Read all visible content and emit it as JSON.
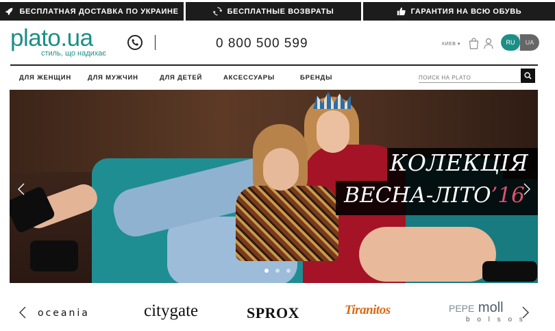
{
  "promo": {
    "items": [
      {
        "icon": "rocket-icon",
        "label": "БЕСПЛАТНАЯ ДОСТАВКА ПО УКРАИНЕ"
      },
      {
        "icon": "refresh-icon",
        "label": "БЕСПЛАТНЫЕ ВОЗВРАТЫ"
      },
      {
        "icon": "thumbs-up-icon",
        "label": "ГАРАНТИЯ НА ВСЮ ОБУВЬ"
      }
    ]
  },
  "header": {
    "logo": "plato.ua",
    "tagline": "стиль, що надихає",
    "phone": "0 800 500 599",
    "city": "КИЕВ ▾",
    "lang": {
      "active": "RU",
      "inactive": "UA"
    }
  },
  "nav": {
    "items": [
      "ДЛЯ ЖЕНЩИН",
      "ДЛЯ МУЖЧИН",
      "ДЛЯ ДЕТЕЙ",
      "АКСЕССУАРЫ",
      "БРЕНДЫ"
    ],
    "search_placeholder": "ПОИСК НА PLATO"
  },
  "hero": {
    "line1": "КОЛЕКЦІЯ",
    "line2": "ВЕСНА-ЛІТО",
    "line2_accent": "’16",
    "slides": 3,
    "active_slide": 1
  },
  "brands": {
    "items": [
      "oceania",
      "citygate",
      "SPROX",
      "Tiranitos",
      "PEPE",
      "moll"
    ],
    "pepemoll_sub": "b o l s o s"
  },
  "colors": {
    "brand_teal": "#1b8f85",
    "promo_bg": "#1c1c1c",
    "accent_pink": "#e0506f"
  }
}
